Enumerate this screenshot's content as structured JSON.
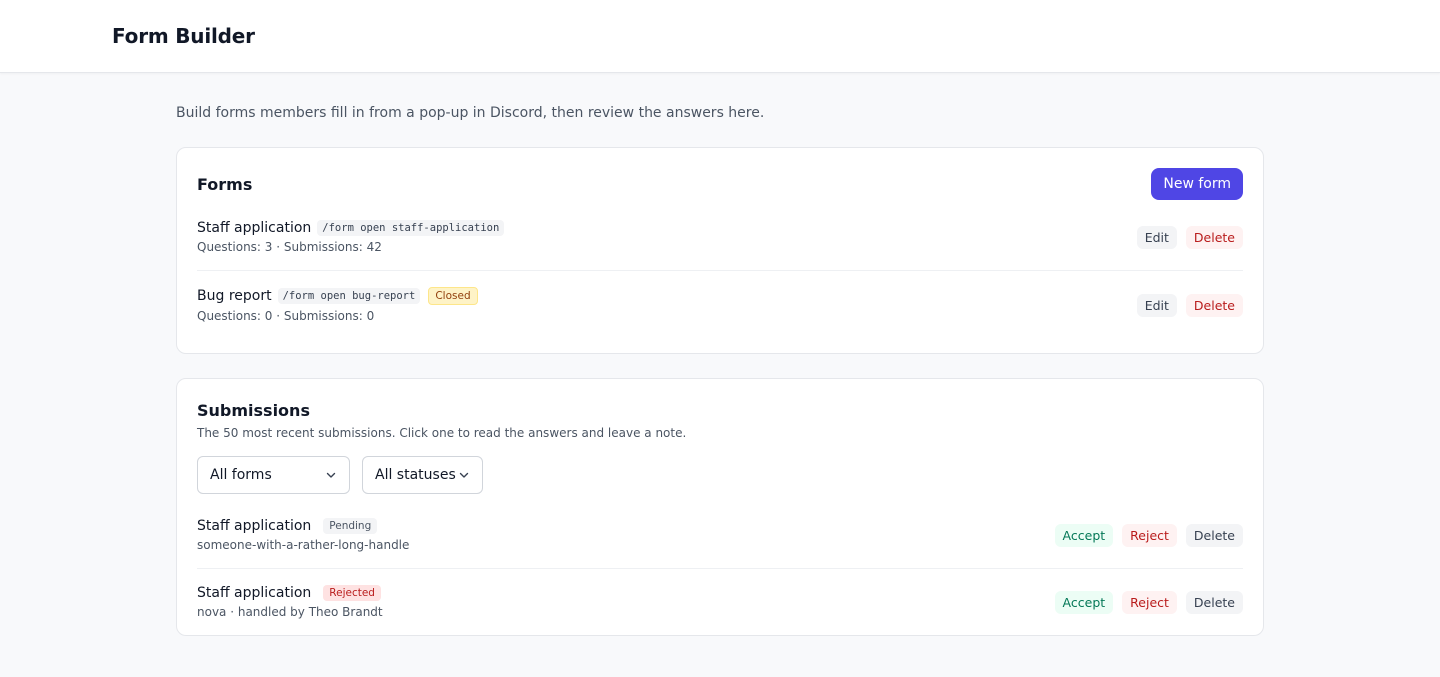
{
  "app": {
    "title": "Form Builder"
  },
  "intro": "Build forms members fill in from a pop-up in Discord, then review the answers here.",
  "forms": {
    "title": "Forms",
    "new_button": "New form",
    "items": [
      {
        "name": "Staff application",
        "command": "/form open staff-application",
        "badge": "",
        "meta": "Questions: 3 · Submissions: 42",
        "edit": "Edit",
        "delete": "Delete"
      },
      {
        "name": "Bug report",
        "command": "/form open bug-report",
        "badge": "Closed",
        "meta": "Questions: 0 · Submissions: 0",
        "edit": "Edit",
        "delete": "Delete"
      }
    ]
  },
  "submissions": {
    "title": "Submissions",
    "description": "The 50 most recent submissions. Click one to read the answers and leave a note.",
    "filters": {
      "form": "All forms",
      "status": "All statuses"
    },
    "items": [
      {
        "form": "Staff application",
        "status": "Pending",
        "meta": "someone-with-a-rather-long-handle",
        "accept": "Accept",
        "reject": "Reject",
        "delete": "Delete"
      },
      {
        "form": "Staff application",
        "status": "Rejected",
        "meta": "nova · handled by Theo Brandt",
        "accept": "Accept",
        "reject": "Reject",
        "delete": "Delete"
      }
    ]
  },
  "colors": {
    "accent": "#4f46e5",
    "danger": "#b91c1c",
    "success": "#047857",
    "warning": "#92400e"
  }
}
